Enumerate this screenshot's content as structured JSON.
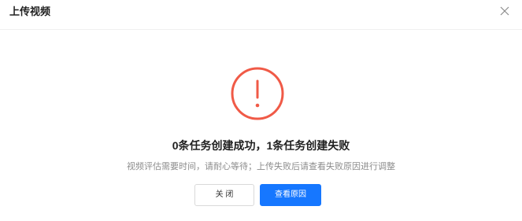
{
  "dialog": {
    "title": "上传视频",
    "close_icon": "close-icon",
    "status_icon": "exclamation-circle-icon",
    "result_text": "0条任务创建成功，1条任务创建失败",
    "hint_text": "视频评估需要时间，请耐心等待；上传失败后请查看失败原因进行调整",
    "close_button_label": "关 闭",
    "view_reason_button_label": "查看原因"
  },
  "colors": {
    "warning_red": "#f05a47",
    "primary_blue": "#1677ff"
  }
}
